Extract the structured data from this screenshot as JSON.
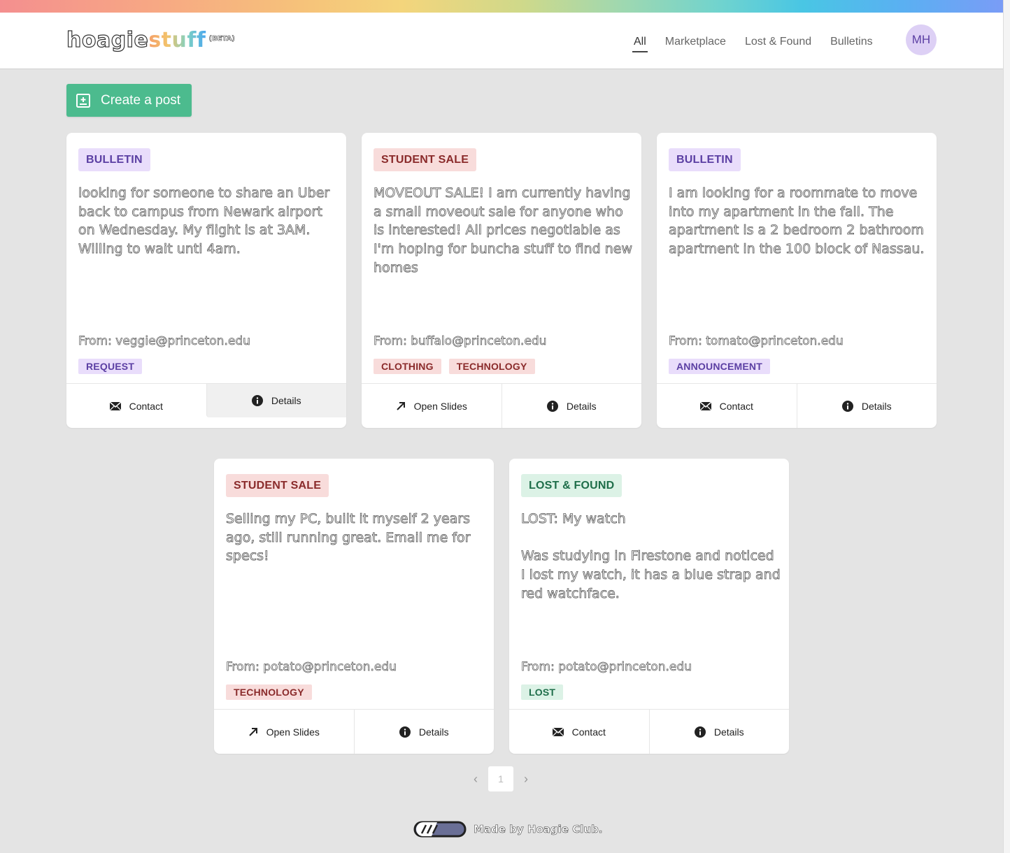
{
  "brand": {
    "name_part1": "hoagie",
    "name_part2": "stuff",
    "beta": "(BETA)"
  },
  "nav": {
    "links": [
      {
        "label": "All",
        "active": true
      },
      {
        "label": "Marketplace"
      },
      {
        "label": "Lost & Found"
      },
      {
        "label": "Bulletins"
      }
    ],
    "avatar_initials": "MH"
  },
  "create_button": {
    "label": "Create a post",
    "icon": "add-box-icon"
  },
  "cards": [
    {
      "badge": "BULLETIN",
      "description": "looking for someone to share an Uber back to campus from Newark airport on Wednesday. My flight is at 3AM. Willing to wait unti 4am.",
      "from": "From: veggie@princeton.edu",
      "tags": [
        "REQUEST"
      ],
      "action1": "Contact",
      "action2": "Details"
    },
    {
      "badge": "STUDENT SALE",
      "description": "MOVEOUT SALE! I am currently having a small moveout sale for anyone who is interested! All prices negotiable as I'm hoping for buncha stuff to find new homes",
      "from": "From: buffalo@princeton.edu",
      "tags": [
        "CLOTHING",
        "TECHNOLOGY"
      ],
      "action1": "Open Slides",
      "action2": "Details"
    },
    {
      "badge": "BULLETIN",
      "description": "I am looking for a roommate to move into my apartment in the fall. The apartment is a 2 bedroom 2 bathroom apartment in the 100 block of Nassau.",
      "from": "From: tomato@princeton.edu",
      "tags": [
        "ANNOUNCEMENT"
      ],
      "action1": "Contact",
      "action2": "Details"
    },
    {
      "badge": "STUDENT SALE",
      "description": "Selling my PC, built it myself 2 years ago, still running great. Email me for specs!",
      "from": "From: potato@princeton.edu",
      "tags": [
        "TECHNOLOGY"
      ],
      "action1": "Open Slides",
      "action2": "Details"
    },
    {
      "badge": "LOST & FOUND",
      "description": "LOST: My watch\n\nWas studying in Firestone and noticed I lost my watch, it has a blue strap and red watchface.",
      "from": "From: potato@princeton.edu",
      "tags": [
        "LOST"
      ],
      "action1": "Contact",
      "action2": "Details"
    }
  ],
  "pagination": {
    "current": "1",
    "prev": "‹",
    "next": "›"
  },
  "footer": {
    "text": "Made by Hoagie Club."
  }
}
